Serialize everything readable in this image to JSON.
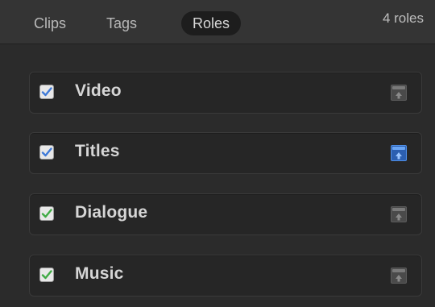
{
  "tabs": [
    {
      "label": "Clips",
      "active": false
    },
    {
      "label": "Tags",
      "active": false
    },
    {
      "label": "Roles",
      "active": true
    }
  ],
  "roles_count": "4 roles",
  "colors": {
    "check_video": "#3f7ad8",
    "check_titles": "#3f7ad8",
    "check_dialogue": "#3faa44",
    "check_music": "#3faa44",
    "lane_inactive": "#6a6a6a",
    "lane_active": "#3a78d4"
  },
  "roles": [
    {
      "label": "Video",
      "checked": true,
      "check_color": "#3f7ad8",
      "lane_active": false,
      "lane_icon": "lane-up-icon"
    },
    {
      "label": "Titles",
      "checked": true,
      "check_color": "#3f7ad8",
      "lane_active": true,
      "lane_icon": "lane-up-icon"
    },
    {
      "label": "Dialogue",
      "checked": true,
      "check_color": "#3faa44",
      "lane_active": false,
      "lane_icon": "lane-up-icon"
    },
    {
      "label": "Music",
      "checked": true,
      "check_color": "#3faa44",
      "lane_active": false,
      "lane_icon": "lane-up-icon"
    }
  ]
}
